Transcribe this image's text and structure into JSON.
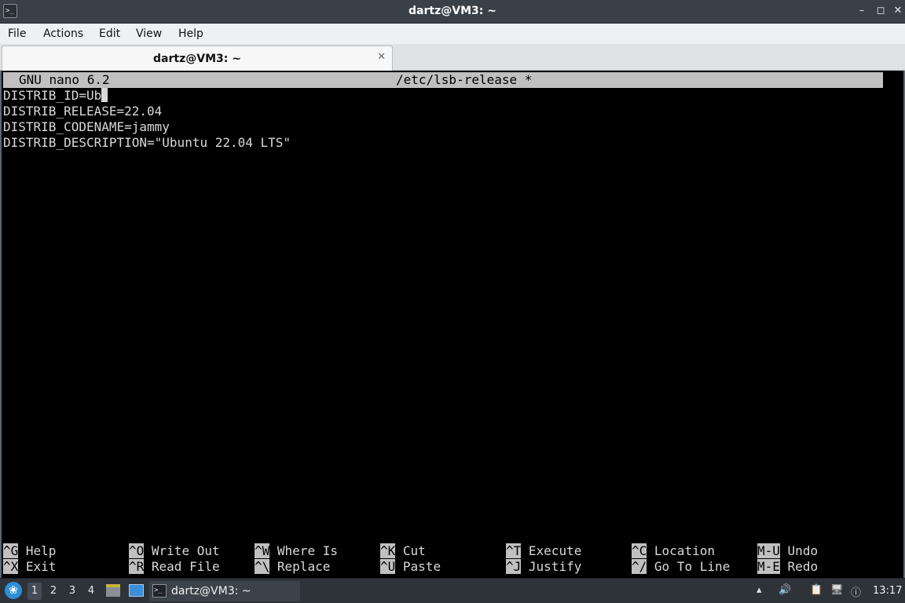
{
  "window": {
    "title": "dartz@VM3: ~",
    "controls": {
      "minimize": "–",
      "maximize": "◻",
      "close": "✕"
    }
  },
  "menu": [
    "File",
    "Actions",
    "Edit",
    "View",
    "Help"
  ],
  "tab": {
    "label": "dartz@VM3: ~",
    "close": "✕"
  },
  "nano": {
    "version": "GNU nano 6.2",
    "filename": "/etc/lsb-release *",
    "lines": [
      "DISTRIB_ID=Ub",
      "DISTRIB_RELEASE=22.04",
      "DISTRIB_CODENAME=jammy",
      "DISTRIB_DESCRIPTION=\"Ubuntu 22.04 LTS\""
    ],
    "shortcuts_row1": [
      {
        "key": "^G",
        "label": "Help"
      },
      {
        "key": "^O",
        "label": "Write Out"
      },
      {
        "key": "^W",
        "label": "Where Is"
      },
      {
        "key": "^K",
        "label": "Cut"
      },
      {
        "key": "^T",
        "label": "Execute"
      },
      {
        "key": "^C",
        "label": "Location"
      },
      {
        "key": "M-U",
        "label": "Undo"
      }
    ],
    "shortcuts_row2": [
      {
        "key": "^X",
        "label": "Exit"
      },
      {
        "key": "^R",
        "label": "Read File"
      },
      {
        "key": "^\\",
        "label": "Replace"
      },
      {
        "key": "^U",
        "label": "Paste"
      },
      {
        "key": "^J",
        "label": "Justify"
      },
      {
        "key": "^/",
        "label": "Go To Line"
      },
      {
        "key": "M-E",
        "label": "Redo"
      }
    ]
  },
  "taskbar": {
    "workspaces": [
      "1",
      "2",
      "3",
      "4"
    ],
    "active_workspace": "1",
    "task_label": "dartz@VM3: ~",
    "clock": "13:17",
    "icons": [
      "start-menu-icon",
      "file-manager-icon",
      "show-desktop-icon",
      "terminal-icon",
      "volume-icon",
      "clipboard-icon",
      "network-icon",
      "update-notifier-icon"
    ]
  },
  "colors": {
    "titlebar": "#394048",
    "terminal_bg": "#000000",
    "terminal_fg": "#d8d8d8",
    "nano_bar": "#c0c0c0",
    "taskbar": "#2e3339"
  }
}
